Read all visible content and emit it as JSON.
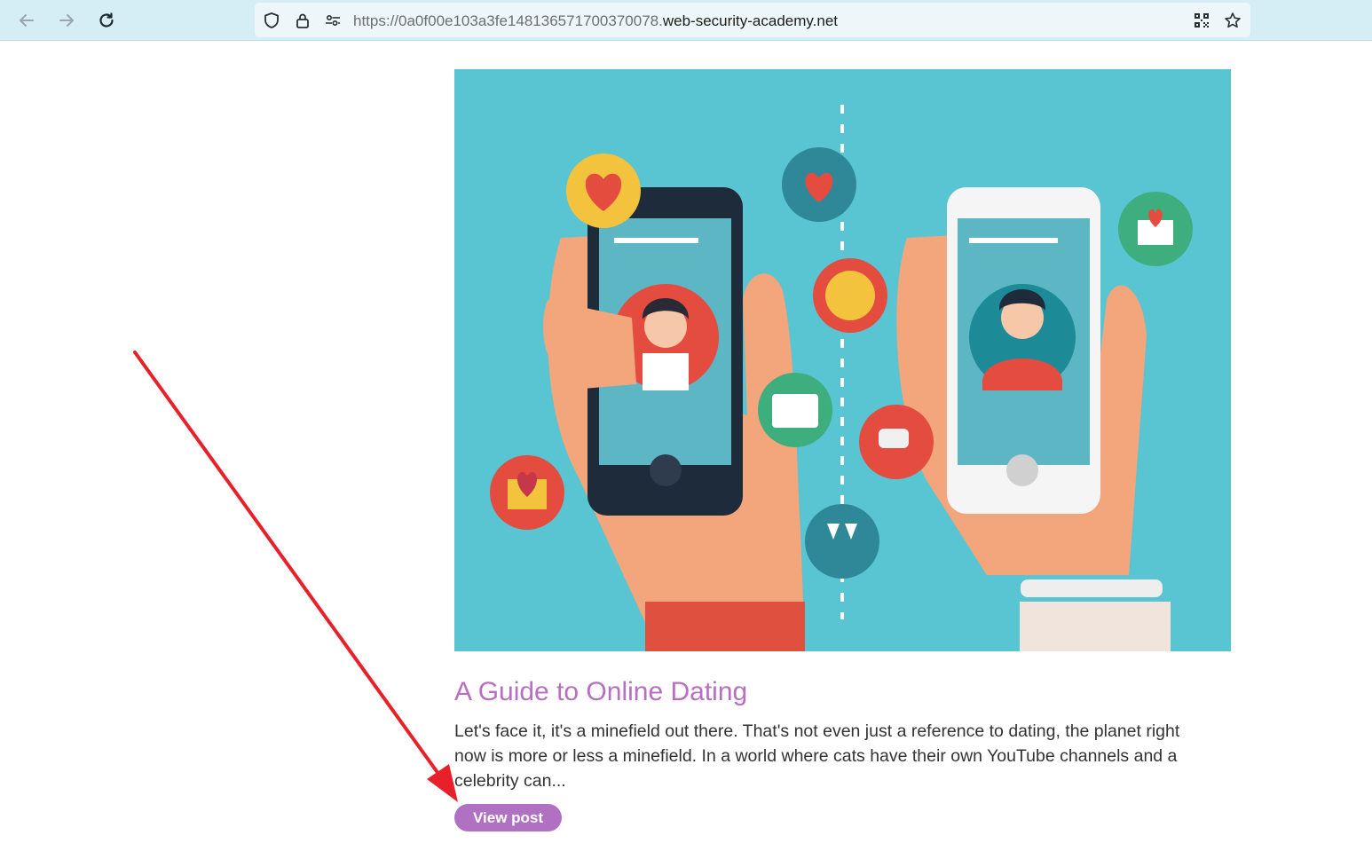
{
  "browser": {
    "url_prefix": "https://0a0f00e103a3fe148136571700370078.",
    "url_host": "web-security-academy.net",
    "icons": [
      "back-arrow-icon",
      "forward-arrow-icon",
      "reload-icon",
      "shield-icon",
      "lock-icon",
      "permissions-icon",
      "qr-code-icon",
      "star-icon"
    ]
  },
  "post": {
    "image_alt": "Two hands holding phones with dating app profiles",
    "title": "A Guide to Online Dating",
    "excerpt": "Let's face it, it's a minefield out there. That's not even just a reference to dating, the planet right now is more or less a minefield. In a world where cats have their own YouTube channels and a celebrity can...",
    "button_label": "View post"
  },
  "colors": {
    "toolbar_bg": "#d5eef5",
    "title": "#b86fc1",
    "button_bg": "#b071c2",
    "image_bg": "#59c4d2",
    "annotation_arrow": "#e8202a"
  }
}
